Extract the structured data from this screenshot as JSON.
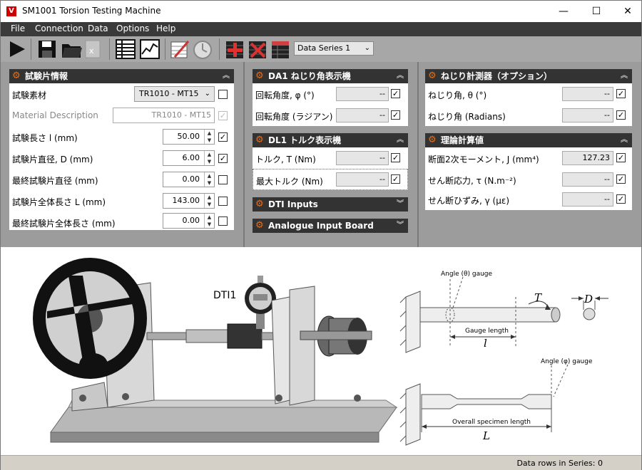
{
  "window": {
    "title": "SM1001 Torsion Testing Machine",
    "icon_letter": "V"
  },
  "menu": {
    "file": "File",
    "connection": "Connection",
    "data": "Data",
    "options": "Options",
    "help": "Help"
  },
  "toolbar": {
    "series_select": "Data Series 1"
  },
  "specimen_panel": {
    "title": "試験片情報",
    "material_label": "試験素材",
    "material_value": "TR1010 - MT15",
    "description_label": "Material Description",
    "description_value": "TR1010 - MT15",
    "length_label": "試験長さ l (mm)",
    "length_value": "50.00",
    "diameter_label": "試験片直径, D (mm)",
    "diameter_value": "6.00",
    "final_diameter_label": "最終試験片直径 (mm)",
    "final_diameter_value": "0.00",
    "overall_length_label": "試験片全体長さ L (mm)",
    "overall_length_value": "143.00",
    "final_overall_length_label": "最終試験片全体長さ (mm)",
    "final_overall_length_value": "0.00"
  },
  "da1_panel": {
    "title": "DA1 ねじり角表示機",
    "rotation_deg_label": "回転角度, φ (°)",
    "rotation_deg_value": "--",
    "rotation_rad_label": "回転角度 (ラジアン)",
    "rotation_rad_value": "--"
  },
  "dl1_panel": {
    "title": "DL1 トルク表示機",
    "torque_label": "トルク, T (Nm)",
    "torque_value": "--",
    "max_torque_label": "最大トルク (Nm)",
    "max_torque_value": "--"
  },
  "dti_panel": {
    "title": "DTI Inputs"
  },
  "analogue_panel": {
    "title": "Analogue Input Board"
  },
  "twist_panel": {
    "title": "ねじり計測器（オプション）",
    "angle_deg_label": "ねじり角, θ (°)",
    "angle_deg_value": "--",
    "angle_rad_label": "ねじり角 (Radians)",
    "angle_rad_value": "--"
  },
  "theory_panel": {
    "title": "理論計算値",
    "polar_label": "断面2次モーメント, J (mm⁴)",
    "polar_value": "127.23",
    "shear_stress_label": "せん断応力, τ (N.m⁻²)",
    "shear_stress_value": "--",
    "shear_strain_label": "せん断ひずみ, γ (με)",
    "shear_strain_value": "--"
  },
  "diagram": {
    "dti_label": "DTI1",
    "angle_theta_gauge": "Angle (θ) gauge",
    "gauge_length": "Gauge length",
    "l_symbol": "l",
    "T_symbol": "T",
    "D_symbol": "D",
    "angle_phi_gauge": "Angle (φ) gauge",
    "overall_length": "Overall specimen length",
    "L_symbol": "L"
  },
  "status": {
    "rows": "Data rows in Series: 0"
  }
}
